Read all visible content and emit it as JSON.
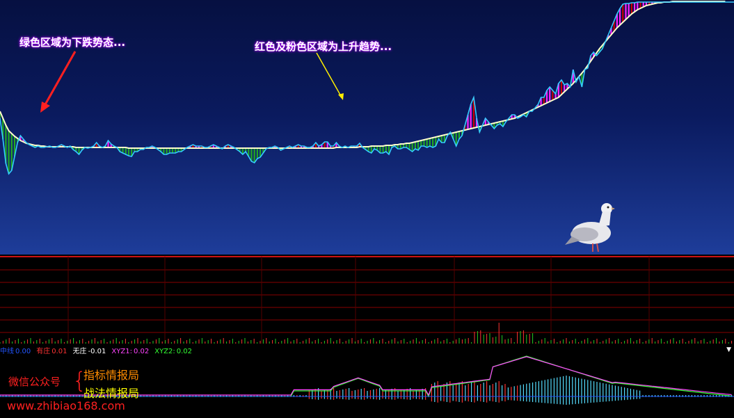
{
  "annotations": {
    "green_note": "绿色区域为下跌势态...",
    "red_note": "红色及粉色区域为上升趋势..."
  },
  "indicator_legend": [
    {
      "label": "中线",
      "value": "0.00",
      "color": "#2255ff"
    },
    {
      "label": "有庄",
      "value": "0.01",
      "color": "#ff3333"
    },
    {
      "label": "无庄",
      "value": "-0.01",
      "color": "#ffffff"
    },
    {
      "label": "XYZ1:",
      "value": "0.02",
      "color": "#ff44ff"
    },
    {
      "label": "XYZ2:",
      "value": "0.02",
      "color": "#33ff33"
    }
  ],
  "watermark": {
    "wechat": "微信公众号",
    "brace": "{",
    "line1": "指标情报局",
    "line2": "战法情报局",
    "url": "www.zhibiao168.com"
  },
  "icons": {
    "bird": "pigeon-image",
    "dropdown": "chevron-down-icon"
  },
  "colors": {
    "up": "#ff22ff",
    "strong_up": "#cc0000",
    "down": "#22aa22",
    "price_line": "#33ccff",
    "ma_line": "#ffffcc",
    "grid": "#aa0000"
  },
  "chart_data": {
    "type": "line",
    "title": "",
    "xlabel": "",
    "ylabel": "",
    "grid": true,
    "price": [
      170,
      200,
      235,
      250,
      245,
      225,
      205,
      195,
      200,
      205,
      208,
      210,
      212,
      210,
      212,
      212,
      211,
      210,
      212,
      212,
      210,
      208,
      210,
      212,
      210,
      215,
      218,
      222,
      216,
      212,
      213,
      212,
      210,
      205,
      210,
      212,
      210,
      202,
      207,
      210,
      212,
      218,
      220,
      222,
      224,
      225,
      218,
      218,
      215,
      215,
      212,
      212,
      210,
      212,
      215,
      218,
      222,
      222,
      220,
      220,
      220,
      218,
      218,
      215,
      212,
      210,
      208,
      210,
      210,
      210,
      212,
      212,
      210,
      208,
      210,
      212,
      214,
      210,
      208,
      210,
      212,
      215,
      218,
      222,
      218,
      225,
      232,
      234,
      228,
      226,
      220,
      214,
      212,
      212,
      210,
      212,
      216,
      214,
      212,
      210,
      212,
      210,
      208,
      210,
      210,
      212,
      212,
      210,
      205,
      210,
      208,
      204,
      204,
      210,
      210,
      205,
      210,
      212,
      210,
      212,
      210,
      210,
      210,
      206,
      212,
      215,
      218,
      220,
      214,
      216,
      220,
      220,
      218,
      222,
      212,
      210,
      214,
      214,
      212,
      212,
      215,
      218,
      214,
      216,
      210,
      210,
      212,
      210,
      212,
      210,
      200,
      205,
      205,
      195,
      190,
      200,
      210,
      200,
      195,
      180,
      165,
      150,
      140,
      170,
      190,
      180,
      170,
      175,
      180,
      185,
      180,
      178,
      182,
      175,
      170,
      165,
      165,
      170,
      168,
      165,
      168,
      160,
      160,
      155,
      150,
      140,
      140,
      130,
      125,
      130,
      135,
      120,
      115,
      122,
      120,
      125,
      100,
      118,
      110,
      125,
      100,
      98,
      80,
      75,
      80,
      75,
      70,
      60,
      50,
      40,
      30,
      20,
      12,
      6,
      5,
      5,
      4,
      4,
      3,
      3,
      3,
      3,
      3,
      3,
      3,
      3,
      3,
      3,
      3,
      3,
      3,
      3,
      3,
      3,
      3,
      3,
      3,
      3,
      3,
      3,
      3,
      3,
      3,
      3,
      3,
      3,
      3,
      3,
      3,
      3,
      3,
      3
    ],
    "ma": [
      160,
      170,
      180,
      188,
      192,
      196,
      199,
      202,
      204,
      206,
      207,
      208,
      209,
      209,
      210,
      210,
      211,
      211,
      211,
      211,
      211,
      211,
      211,
      211,
      211,
      211,
      212,
      212,
      212,
      212,
      212,
      212,
      212,
      212,
      212,
      212,
      212,
      212,
      212,
      212,
      212,
      212,
      212,
      212,
      213,
      213,
      213,
      213,
      213,
      213,
      213,
      213,
      213,
      213,
      213,
      213,
      213,
      213,
      213,
      213,
      213,
      213,
      213,
      213,
      213,
      213,
      213,
      213,
      213,
      213,
      213,
      213,
      213,
      213,
      213,
      213,
      213,
      213,
      213,
      213,
      213,
      213,
      213,
      213,
      213,
      213,
      213,
      213,
      213,
      213,
      213,
      213,
      213,
      213,
      213,
      213,
      213,
      213,
      213,
      213,
      213,
      213,
      213,
      213,
      213,
      213,
      213,
      213,
      213,
      213,
      213,
      213,
      213,
      213,
      213,
      212,
      212,
      212,
      212,
      212,
      212,
      212,
      212,
      211,
      211,
      211,
      211,
      210,
      210,
      210,
      210,
      210,
      209,
      209,
      209,
      208,
      208,
      207,
      207,
      206,
      206,
      205,
      204,
      203,
      202,
      201,
      200,
      199,
      198,
      197,
      196,
      195,
      194,
      193,
      192,
      191,
      190,
      189,
      188,
      187,
      186,
      185,
      184,
      183,
      182,
      181,
      180,
      179,
      178,
      177,
      176,
      175,
      174,
      173,
      172,
      171,
      170,
      168,
      166,
      164,
      162,
      160,
      158,
      156,
      154,
      152,
      150,
      148,
      146,
      144,
      142,
      140,
      136,
      132,
      128,
      124,
      120,
      115,
      110,
      105,
      100,
      94,
      88,
      82,
      76,
      70,
      65,
      60,
      55,
      50,
      45,
      40,
      36,
      32,
      28,
      24,
      20,
      17,
      14,
      12,
      10,
      8,
      7,
      6,
      5,
      4,
      4,
      3,
      3,
      3,
      2,
      2,
      2,
      2,
      2,
      2,
      2,
      2,
      2,
      2,
      2,
      2,
      2,
      2,
      2,
      2,
      2,
      2,
      2
    ]
  }
}
